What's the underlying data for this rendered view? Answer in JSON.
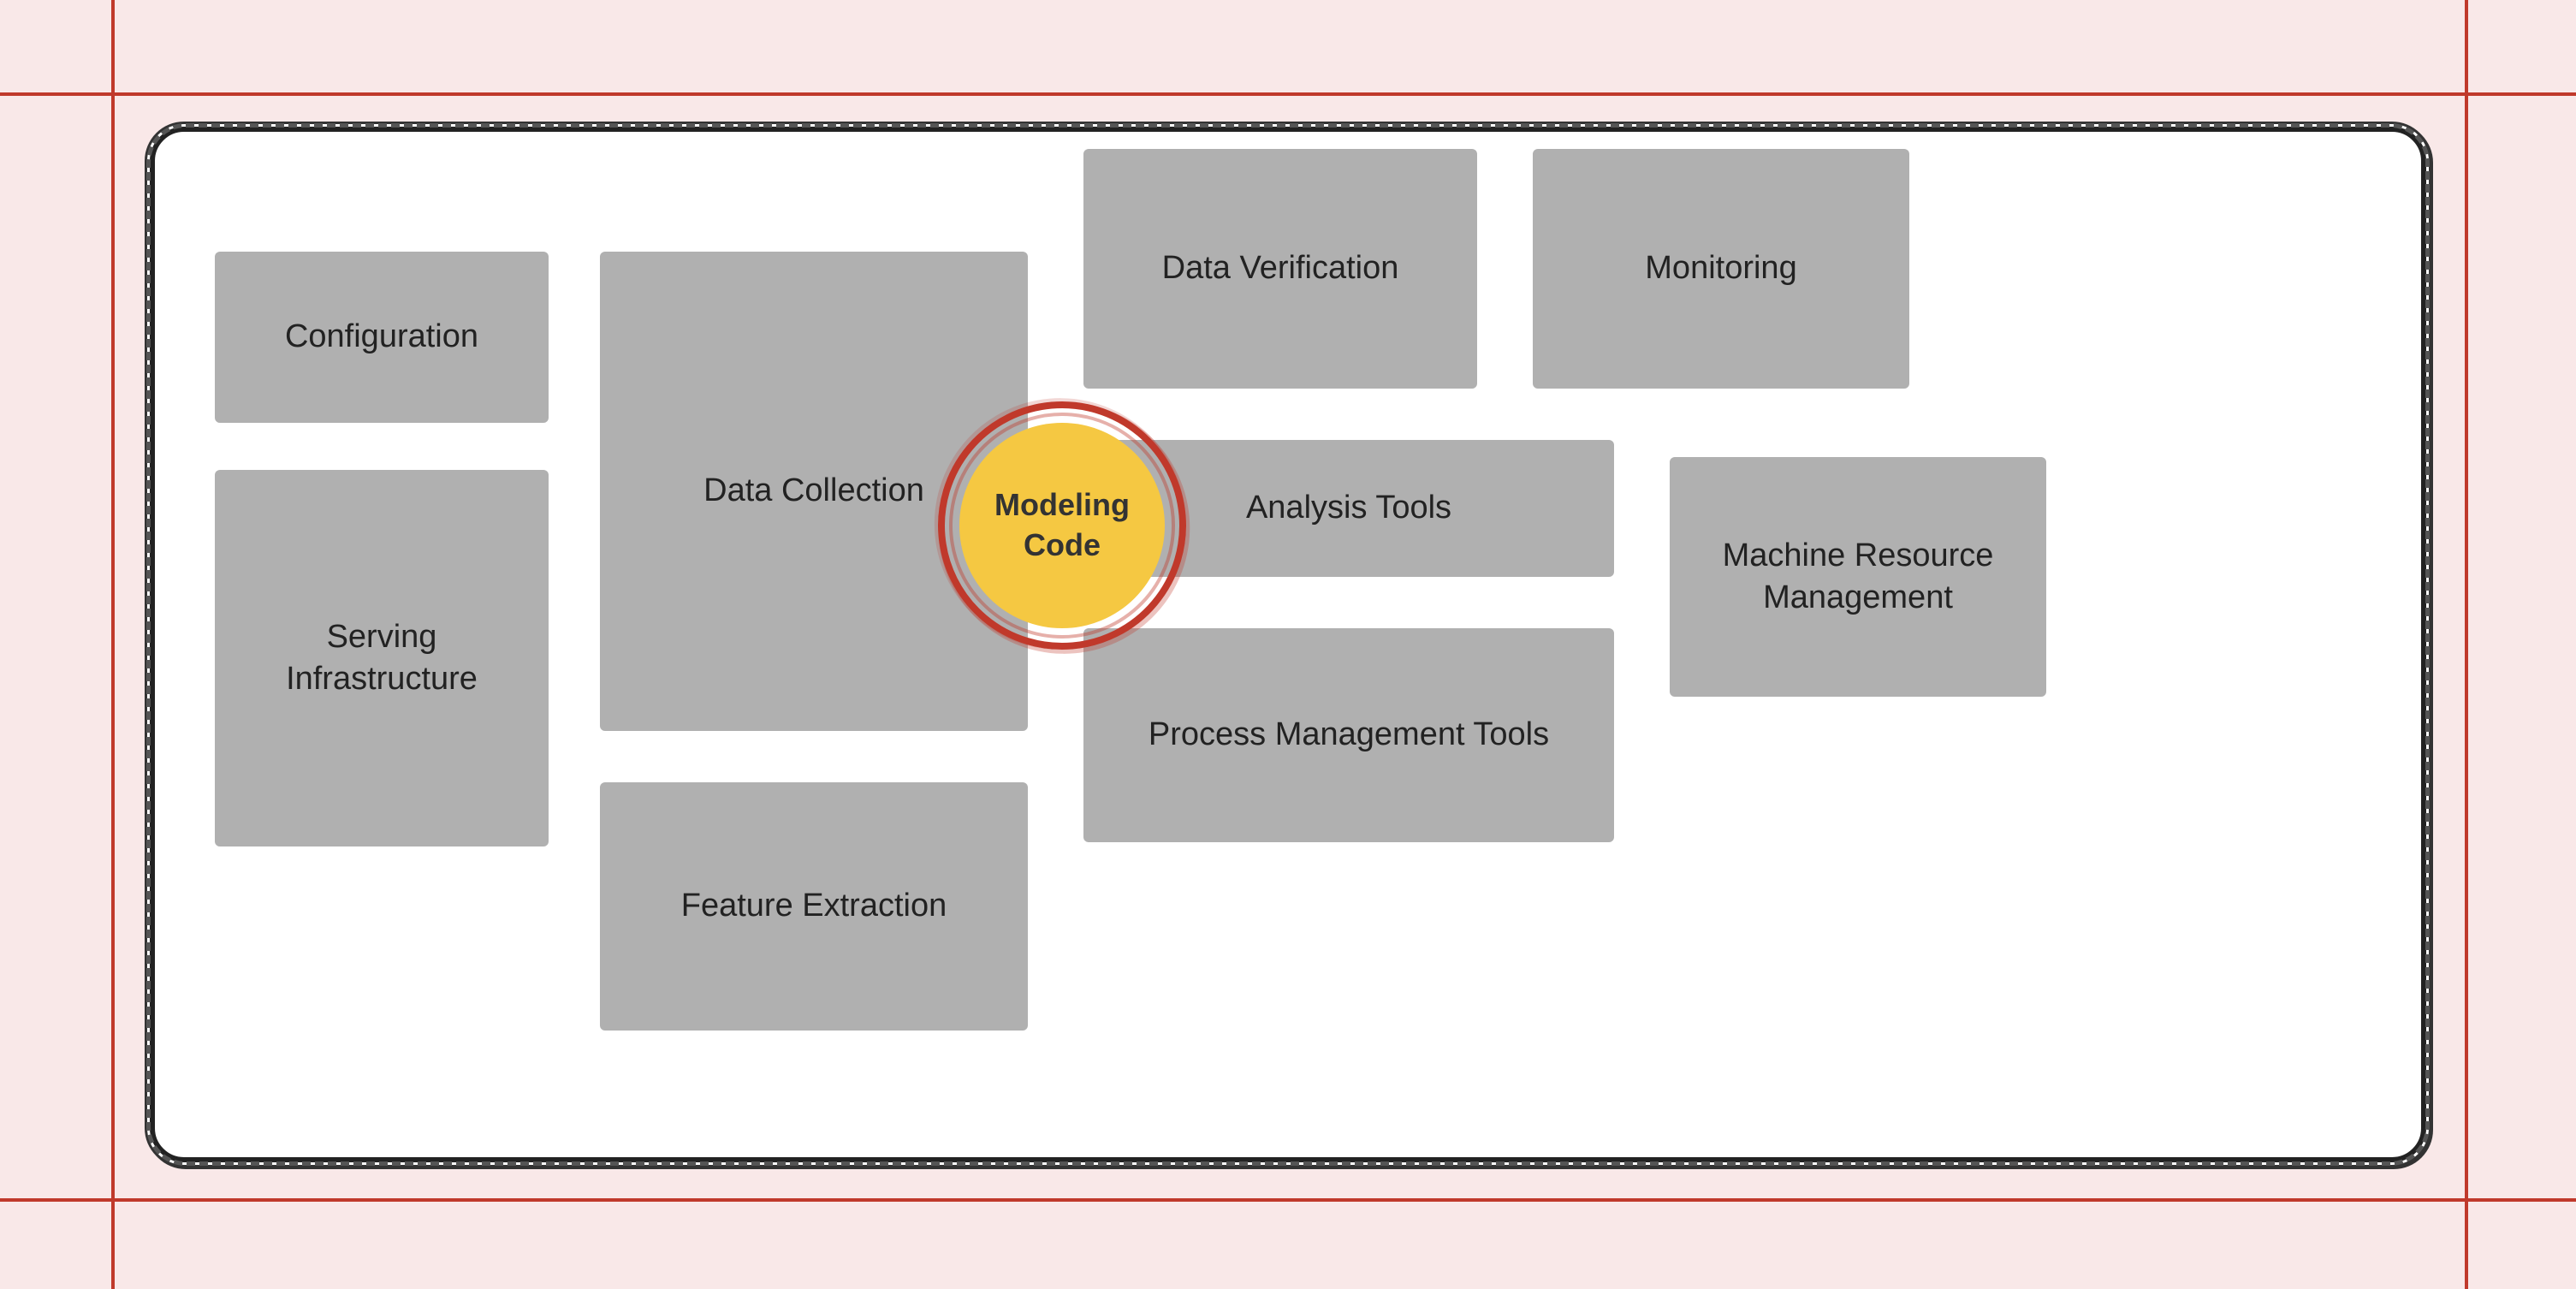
{
  "background_color": "#f9e8e8",
  "blocks": {
    "configuration": {
      "label": "Configuration"
    },
    "serving_infrastructure": {
      "label": "Serving\nInfrastructure"
    },
    "data_collection": {
      "label": "Data Collection"
    },
    "data_verification": {
      "label": "Data Verification"
    },
    "monitoring": {
      "label": "Monitoring"
    },
    "analysis_tools": {
      "label": "Analysis Tools"
    },
    "process_management": {
      "label": "Process Management Tools"
    },
    "feature_extraction": {
      "label": "Feature Extraction"
    },
    "machine_resource": {
      "label": "Machine Resource\nManagement"
    },
    "modeling_code": {
      "label": "Modeling\nCode"
    }
  }
}
